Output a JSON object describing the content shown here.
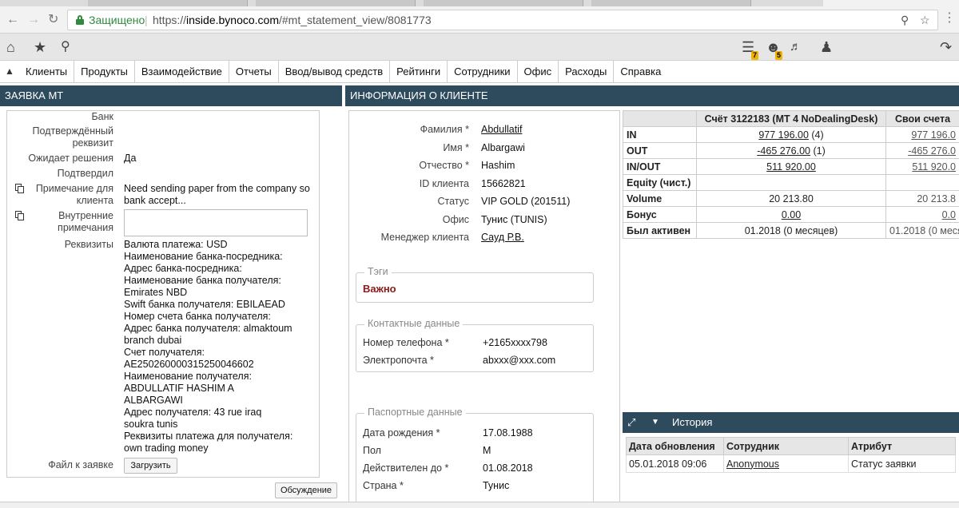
{
  "browser": {
    "secure_label": "Защищено",
    "separator": "|",
    "url_scheme": "https://",
    "url_host": "inside.bynoco.com",
    "url_path": "/#mt_statement_view/8081773"
  },
  "toolbar": {
    "badge_notifications": "7",
    "badge_users": "5"
  },
  "menu": {
    "items": [
      "Клиенты",
      "Продукты",
      "Взаимодействие",
      "Отчеты",
      "Ввод/вывод средств",
      "Рейтинги",
      "Сотрудники",
      "Офис",
      "Расходы",
      "Справка"
    ]
  },
  "left": {
    "header": "ЗАЯВКА МТ",
    "bank_label": "Банк",
    "confirmed_req_label": "Подтверждённый реквизит",
    "awaiting_label": "Ожидает решения",
    "awaiting_value": "Да",
    "confirmed_by_label": "Подтвердил",
    "client_note_label": "Примечание для клиента",
    "client_note_value": "Need sending paper from the company so bank accept...",
    "internal_note_label": "Внутренние примечания",
    "requisites_label": "Реквизиты",
    "requisites_value": "Валюта платежа: USD\nНаименование банка-посредника:\nАдрес банка-посредника:\nНаименование банка получателя:\nEmirates NBD\nSwift банка получателя: EBILAEAD\nНомер счета банка получателя:\nАдрес банка получателя: almaktoum\nbranch dubai\nСчет получателя:\nAE250260000315250046602\nНаименование получателя:\nABDULLATIF HASHIM A\nALBARGAWI\nАдрес получателя: 43 rue iraq\nsoukra tunis\nРеквизиты платежа для получателя:\nown trading money",
    "file_label": "Файл к заявке",
    "upload_button": "Загрузить",
    "discussion_button": "Обсуждение"
  },
  "client": {
    "header": "ИНФОРМАЦИЯ О КЛИЕНТЕ",
    "fields": [
      {
        "label": "Фамилия *",
        "value": "Abdullatif",
        "link": true
      },
      {
        "label": "Имя *",
        "value": "Albargawi",
        "link": false
      },
      {
        "label": "Отчество *",
        "value": "Hashim",
        "link": false
      },
      {
        "label": "ID клиента",
        "value": "15662821",
        "link": false
      },
      {
        "label": "Статус",
        "value": "VIP GOLD (201511)",
        "link": false
      },
      {
        "label": "Офис",
        "value": "Тунис (TUNIS)",
        "link": false
      },
      {
        "label": "Менеджер клиента",
        "value": "Сауд Р.В.",
        "link": true
      }
    ],
    "tags_legend": "Тэги",
    "tag_important": "Важно",
    "contacts_legend": "Контактные данные",
    "phone_label": "Номер телефона *",
    "phone_value": "+2165xxxx798",
    "email_label": "Электропочта *",
    "email_value": "abxxx@xxx.com",
    "passport_legend": "Паспортные данные",
    "birth_label": "Дата рождения *",
    "birth_value": "17.08.1988",
    "sex_label": "Пол",
    "sex_value": "М",
    "valid_label": "Действителен до *",
    "valid_value": "01.08.2018",
    "country_label": "Страна *",
    "country_value": "Тунис"
  },
  "account": {
    "col_account": "Счёт 3122183 (MT 4 NoDealingDesk)",
    "col_own": "Свои счета",
    "rows": [
      {
        "label": "IN",
        "value": "977 196.00",
        "suffix": " (4)",
        "underline": true,
        "own": "977 196.0"
      },
      {
        "label": "OUT",
        "value": "-465 276.00",
        "suffix": " (1)",
        "underline": true,
        "own": "-465 276.0"
      },
      {
        "label": "IN/OUT",
        "value": "511 920.00",
        "suffix": "",
        "underline": true,
        "own": "511 920.0"
      },
      {
        "label": "Equity (чист.)",
        "value": "",
        "suffix": "",
        "underline": false,
        "own": ""
      },
      {
        "label": "Volume",
        "value": "20 213.80",
        "suffix": "",
        "underline": false,
        "own": "20 213.8"
      },
      {
        "label": "Бонус",
        "value": "0.00",
        "suffix": "",
        "underline": true,
        "own": "0.0"
      },
      {
        "label": "Был активен",
        "value": "01.2018 (0 месяцев)",
        "suffix": "",
        "underline": false,
        "own": "01.2018 (0 месяц"
      }
    ]
  },
  "history": {
    "title": "История",
    "col_date": "Дата обновления",
    "col_employee": "Сотрудник",
    "col_attr": "Атрибут",
    "rows": [
      {
        "date": "05.01.2018 09:06",
        "employee": "Anonymous",
        "attr": "Статус заявки"
      }
    ]
  }
}
